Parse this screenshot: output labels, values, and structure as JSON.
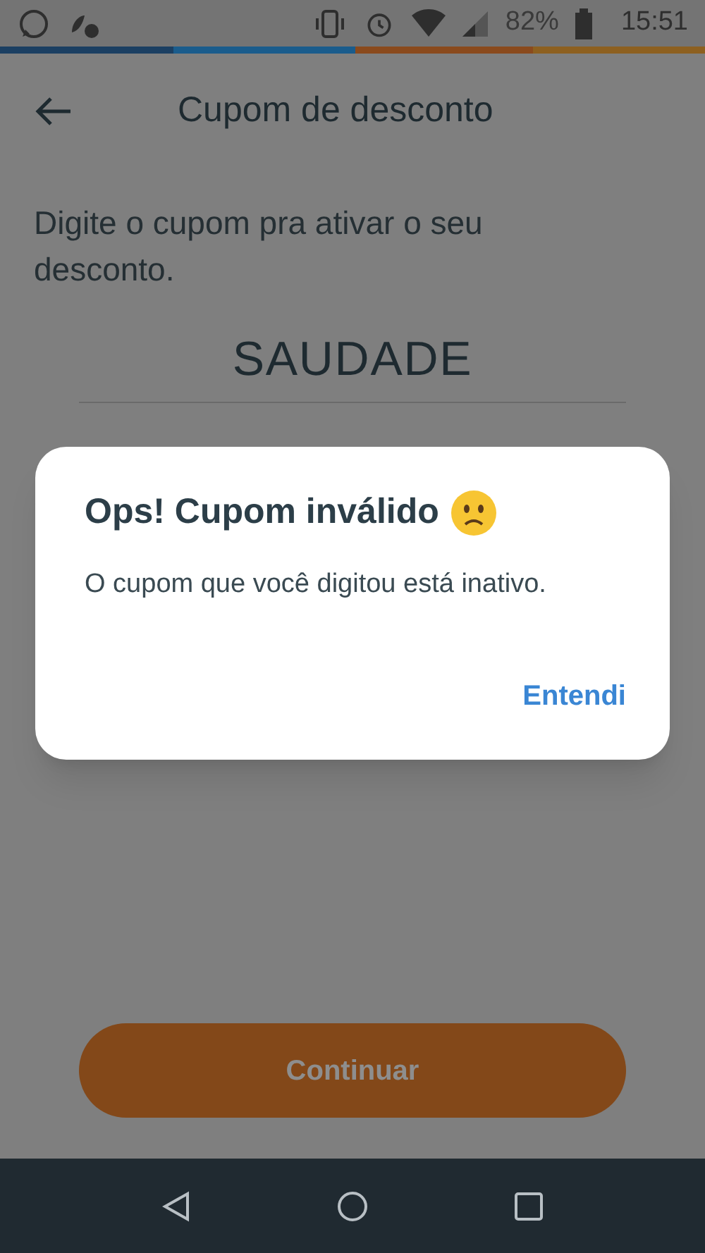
{
  "status_bar": {
    "battery": "82%",
    "time": "15:51"
  },
  "header": {
    "title": "Cupom de desconto"
  },
  "instructions": "Digite o cupom pra ativar o seu desconto.",
  "coupon_field": {
    "value": "SAUDADE"
  },
  "continue_button": {
    "label": "Continuar"
  },
  "dialog": {
    "title": "Ops! Cupom inválido",
    "message": "O cupom que você digitou está inativo.",
    "action": "Entendi"
  }
}
